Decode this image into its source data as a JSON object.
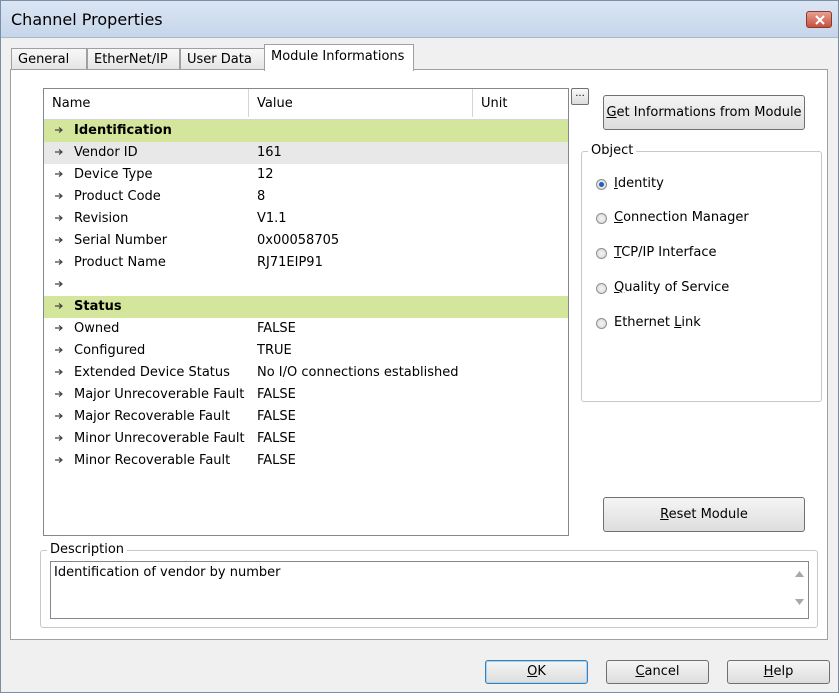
{
  "window": {
    "title": "Channel Properties"
  },
  "tabs": [
    {
      "label": "General"
    },
    {
      "label": "EtherNet/IP"
    },
    {
      "label": "User Data"
    },
    {
      "label": "Module Informations"
    }
  ],
  "table": {
    "columns": {
      "name": "Name",
      "value": "Value",
      "unit": "Unit"
    },
    "rows": [
      {
        "name": "Identification",
        "value": ""
      },
      {
        "name": "Vendor ID",
        "value": "161"
      },
      {
        "name": "Device Type",
        "value": "12"
      },
      {
        "name": "Product Code",
        "value": "8"
      },
      {
        "name": "Revision",
        "value": "V1.1"
      },
      {
        "name": "Serial Number",
        "value": "0x00058705"
      },
      {
        "name": "Product Name",
        "value": "RJ71EIP91"
      },
      {
        "name": "",
        "value": ""
      },
      {
        "name": "Status",
        "value": ""
      },
      {
        "name": "Owned",
        "value": "FALSE"
      },
      {
        "name": "Configured",
        "value": "TRUE"
      },
      {
        "name": "Extended Device Status",
        "value": "No I/O connections established"
      },
      {
        "name": "Major Unrecoverable Fault",
        "value": "FALSE"
      },
      {
        "name": "Major Recoverable Fault",
        "value": "FALSE"
      },
      {
        "name": "Minor Unrecoverable Fault",
        "value": "FALSE"
      },
      {
        "name": "Minor Recoverable Fault",
        "value": "FALSE"
      }
    ]
  },
  "ellipsis_label": "...",
  "get_info_button": {
    "key": "G",
    "rest": "et Informations from Module"
  },
  "object_group": {
    "legend": "Object",
    "options": [
      {
        "key": "I",
        "rest": "dentity"
      },
      {
        "key": "C",
        "rest": "onnection Manager"
      },
      {
        "key": "T",
        "rest": "CP/IP Interface"
      },
      {
        "key": "Q",
        "rest": "uality of Service"
      },
      {
        "pre": "Ethernet ",
        "key": "L",
        "rest": "ink"
      }
    ]
  },
  "reset_button": {
    "key": "R",
    "rest": "eset Module"
  },
  "description": {
    "legend": "Description",
    "text": "Identification of vendor by number"
  },
  "footer": {
    "ok": {
      "key": "O",
      "rest": "K"
    },
    "cancel": {
      "key": "C",
      "rest": "ancel"
    },
    "help": {
      "key": "H",
      "rest": "elp"
    }
  },
  "colors": {
    "section_bg": "#d4e59c",
    "selected_row_bg": "#e8e8e8",
    "default_button_border": "#3c7fb1"
  }
}
